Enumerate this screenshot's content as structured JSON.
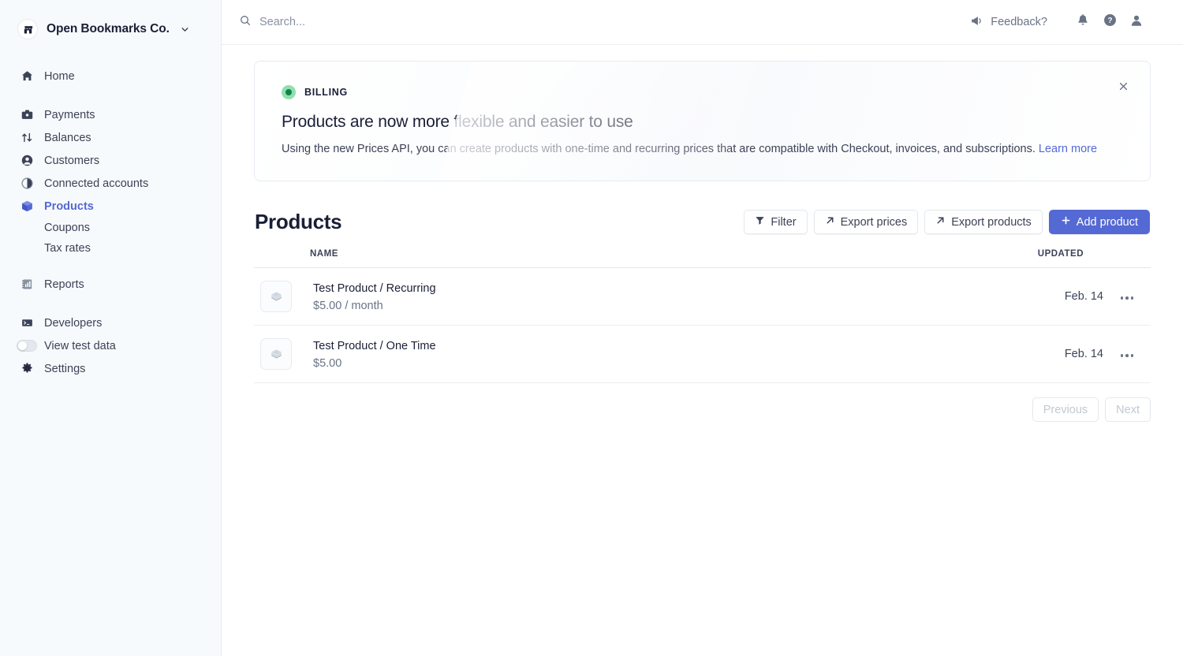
{
  "sidebar": {
    "brand": {
      "name": "Open Bookmarks Co.",
      "logo_icon": "storefront-icon",
      "caret_icon": "chevron-down-icon"
    },
    "primary": [
      {
        "label": "Home",
        "icon": "home-icon",
        "active": false
      }
    ],
    "groups": [
      {
        "label": "Payments",
        "icon": "payments-icon",
        "active": false
      },
      {
        "label": "Balances",
        "icon": "balances-arrows-icon",
        "active": false
      },
      {
        "label": "Customers",
        "icon": "customers-person-icon",
        "active": false
      },
      {
        "label": "Connected accounts",
        "icon": "connected-accounts-pie-icon",
        "active": false
      },
      {
        "label": "Products",
        "icon": "products-cube-icon",
        "active": true
      }
    ],
    "sub_items": [
      {
        "label": "Coupons"
      },
      {
        "label": "Tax rates"
      }
    ],
    "reports": {
      "label": "Reports",
      "icon": "reports-chart-icon"
    },
    "developers": {
      "label": "Developers",
      "icon": "developers-terminal-icon"
    },
    "view_test_data": {
      "label": "View test data",
      "icon": "toggle-switch-icon",
      "enabled": false
    },
    "settings": {
      "label": "Settings",
      "icon": "gear-icon"
    }
  },
  "topbar": {
    "search": {
      "placeholder": "Search...",
      "icon": "search-icon",
      "value": ""
    },
    "feedback": {
      "label": "Feedback?",
      "icon": "megaphone-icon"
    },
    "notifications_icon": "bell-icon",
    "help_icon": "question-circle-icon",
    "account_icon": "user-avatar-icon",
    "close_icon": "close-icon"
  },
  "banner": {
    "eyebrow": "BILLING",
    "eyebrow_icon": "green-dot-icon",
    "title": "Products are now more flexible and easier to use",
    "description": "Using the new Prices API, you can create products with one-time and recurring prices that are compatible with Checkout, invoices, and subscriptions.",
    "link_label": "Learn more",
    "dismiss_icon": "close-icon"
  },
  "page": {
    "title": "Products",
    "actions": {
      "filter": {
        "label": "Filter",
        "icon": "funnel-icon"
      },
      "export_prices": {
        "label": "Export prices",
        "icon": "arrow-up-right-icon"
      },
      "export_products": {
        "label": "Export products",
        "icon": "arrow-up-right-icon"
      },
      "add_product": {
        "label": "Add product",
        "icon": "plus-icon"
      }
    }
  },
  "table": {
    "columns": {
      "name": "NAME",
      "updated": "UPDATED"
    },
    "rows": [
      {
        "name": "Test Product / Recurring",
        "price": "$5.00 / month",
        "updated": "Feb. 14",
        "thumb_icon": "box-icon",
        "menu_icon": "overflow-menu-icon"
      },
      {
        "name": "Test Product / One Time",
        "price": "$5.00",
        "updated": "Feb. 14",
        "thumb_icon": "box-icon",
        "menu_icon": "overflow-menu-icon"
      }
    ]
  },
  "pagination": {
    "previous_label": "Previous",
    "next_label": "Next"
  },
  "colors": {
    "accent": "#5469d4",
    "sidebar_bg": "#f7fafc",
    "text_primary": "#1a1f36",
    "text_muted": "#697386",
    "badge_green": "#14804a"
  }
}
